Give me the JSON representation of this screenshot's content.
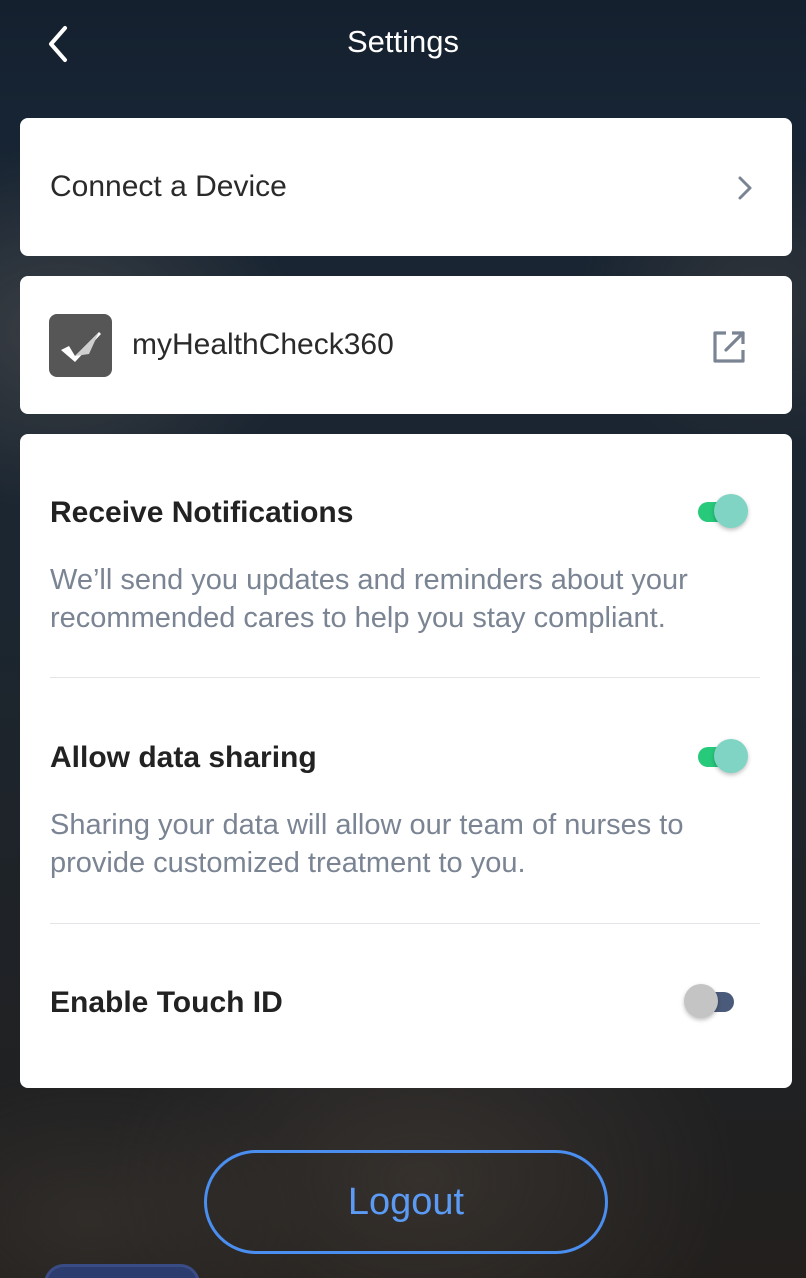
{
  "header": {
    "title": "Settings",
    "back_icon": "chevron-left-icon"
  },
  "connect": {
    "label": "Connect a Device",
    "icon": "chevron-right-icon"
  },
  "app_link": {
    "label": "myHealthCheck360",
    "logo_icon": "checkmark-logo-icon",
    "icon": "external-link-icon"
  },
  "preferences": {
    "notifications": {
      "title": "Receive Notifications",
      "description": "We’ll send you updates and reminders about your recommended cares to help you stay compliant.",
      "enabled": true
    },
    "data_sharing": {
      "title": "Allow data sharing",
      "description": "Sharing your data will allow our team of nurses to provide customized treatment to you.",
      "enabled": true
    },
    "touch_id": {
      "title": "Enable Touch ID",
      "enabled": false
    }
  },
  "logout": {
    "label": "Logout"
  },
  "colors": {
    "accent": "#4a8ef0",
    "toggle_on": "#27c97b",
    "toggle_knob_on": "#7fd4c4",
    "toggle_off": "#4a5a7a",
    "description_text": "#7a8493"
  }
}
